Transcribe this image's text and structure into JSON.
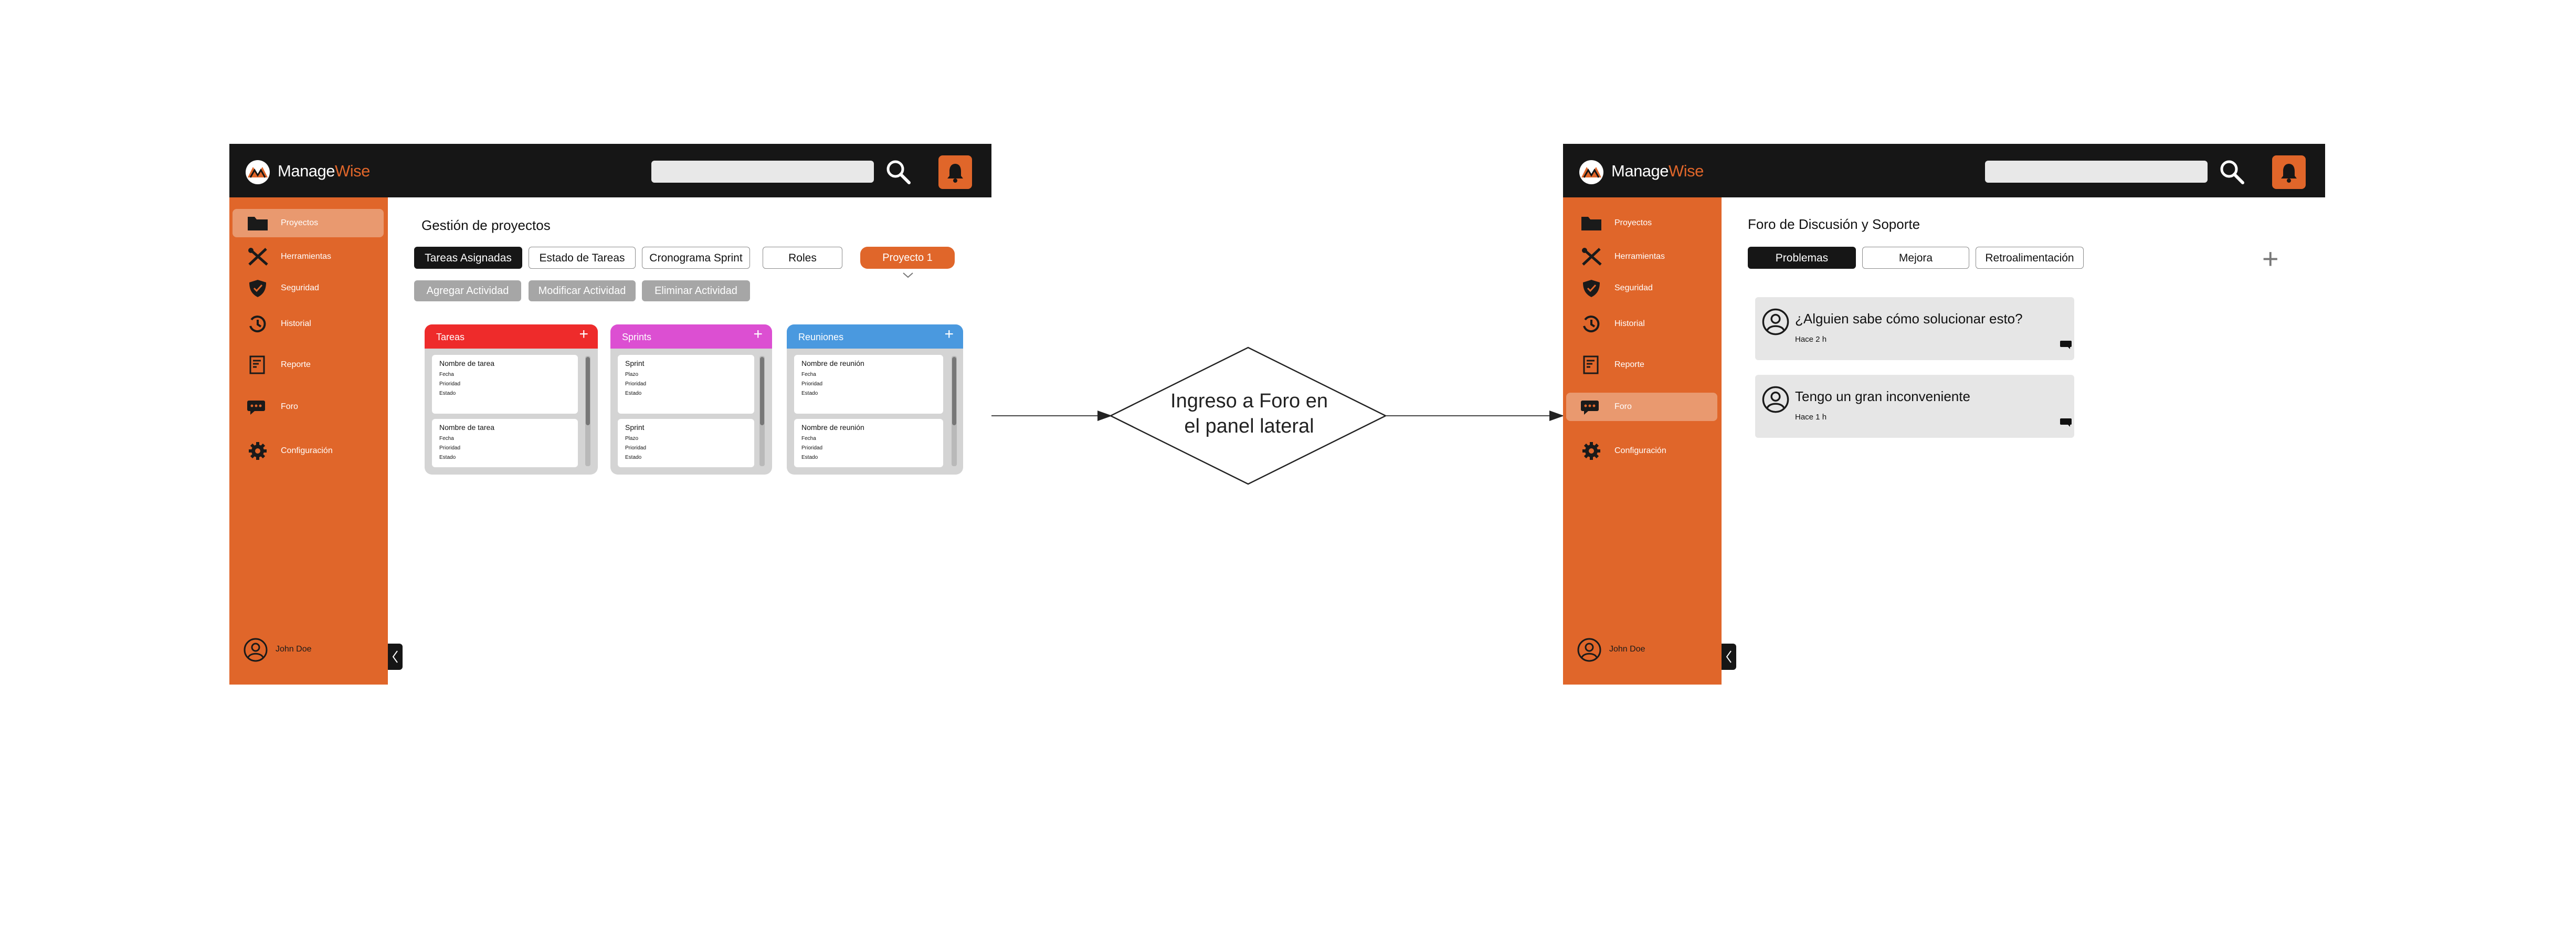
{
  "colors": {
    "accent": "#e0662a",
    "topbar": "#161616",
    "tareas": "#ee2b2b",
    "sprints": "#dc4fd2",
    "reuniones": "#4a99df"
  },
  "brand": {
    "name_part1": "Manage",
    "name_part2": "Wise"
  },
  "sidebar": {
    "items": [
      {
        "label": "Proyectos",
        "icon": "folder-icon"
      },
      {
        "label": "Herramientas",
        "icon": "tools-icon"
      },
      {
        "label": "Seguridad",
        "icon": "shield-icon"
      },
      {
        "label": "Historial",
        "icon": "history-icon"
      },
      {
        "label": "Reporte",
        "icon": "report-icon"
      },
      {
        "label": "Foro",
        "icon": "chat-icon"
      },
      {
        "label": "Configuración",
        "icon": "gear-icon"
      }
    ],
    "user": "John Doe"
  },
  "projects_screen": {
    "title": "Gestión de proyectos",
    "tabs": [
      "Tareas Asignadas",
      "Estado de Tareas",
      "Cronograma Sprint",
      "Roles"
    ],
    "project_select": "Proyecto 1",
    "actions": [
      "Agregar Actividad",
      "Modificar Actividad",
      "Eliminar Actividad"
    ],
    "columns": [
      {
        "title": "Tareas",
        "cards": [
          {
            "title": "Nombre de tarea",
            "lines": [
              "Fecha",
              "Prioridad",
              "Estado"
            ]
          },
          {
            "title": "Nombre de tarea",
            "lines": [
              "Fecha",
              "Prioridad",
              "Estado"
            ]
          }
        ]
      },
      {
        "title": "Sprints",
        "cards": [
          {
            "title": "Sprint",
            "lines": [
              "Plazo",
              "Prioridad",
              "Estado"
            ]
          },
          {
            "title": "Sprint",
            "lines": [
              "Plazo",
              "Prioridad",
              "Estado"
            ]
          }
        ]
      },
      {
        "title": "Reuniones",
        "cards": [
          {
            "title": "Nombre de reunión",
            "lines": [
              "Fecha",
              "Prioridad",
              "Estado"
            ]
          },
          {
            "title": "Nombre de reunión",
            "lines": [
              "Fecha",
              "Prioridad",
              "Estado"
            ]
          }
        ]
      }
    ],
    "add_symbol": "+"
  },
  "decision": {
    "line1": "Ingreso a Foro en",
    "line2": "el panel lateral"
  },
  "forum_screen": {
    "title": "Foro de Discusión y Soporte",
    "tabs": [
      "Problemas",
      "Mejora",
      "Retroalimentación"
    ],
    "add_symbol": "+",
    "posts": [
      {
        "text": "¿Alguien sabe cómo solucionar esto?",
        "time": "Hace 2 h"
      },
      {
        "text": "Tengo un gran inconveniente",
        "time": "Hace 1 h"
      }
    ]
  }
}
